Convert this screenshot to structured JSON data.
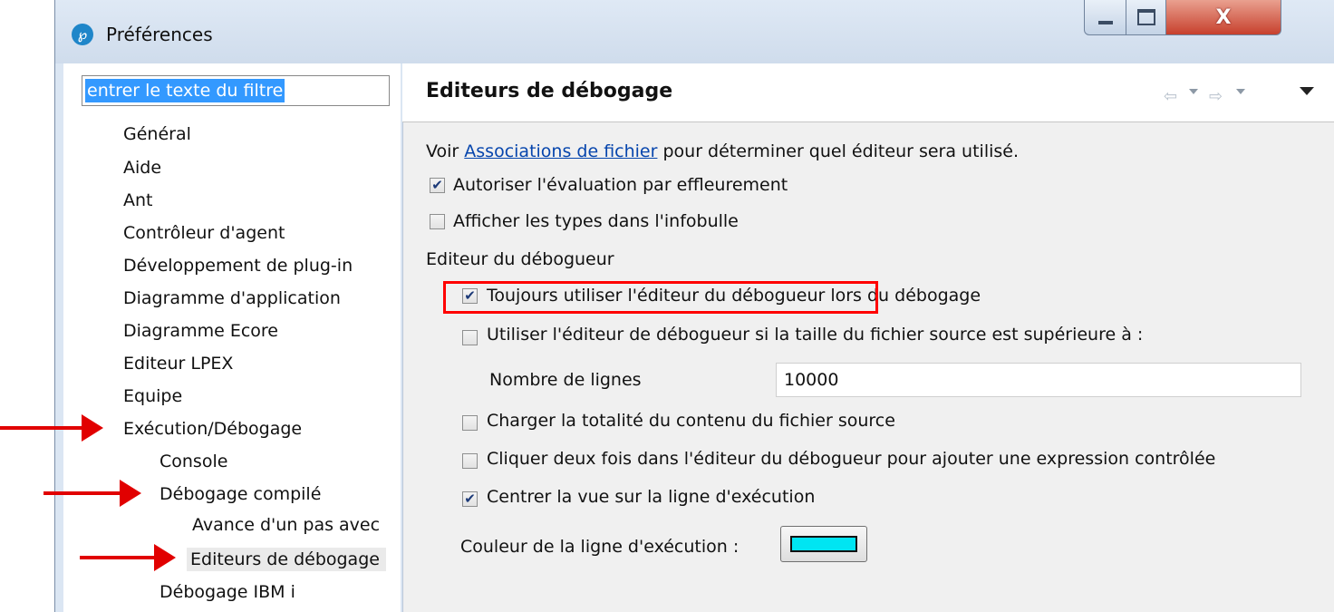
{
  "window": {
    "title": "Préférences",
    "icon": "eclipse-ide-icon",
    "close_label": "X"
  },
  "filter": {
    "value": "entrer le texte du filtre"
  },
  "tree": {
    "general": "Général",
    "aide": "Aide",
    "ant": "Ant",
    "controleur": "Contrôleur d'agent",
    "developpement": "Développement de plug-in",
    "diag_app": "Diagramme d'application",
    "diag_ecore": "Diagramme Ecore",
    "editeur_lpex": "Editeur LPEX",
    "equipe": "Equipe",
    "execution": "Exécution/Débogage",
    "console": "Console",
    "debogage_compile": "Débogage compilé",
    "avance": "Avance d'un pas avec",
    "editeurs": "Editeurs de débogage",
    "debogage_ibm": "Débogage IBM i"
  },
  "page": {
    "title": "Editeurs de débogage",
    "intro_before": "Voir ",
    "intro_link": "Associations de fichier",
    "intro_after": " pour déterminer quel éditeur sera utilisé.",
    "opt_hover": {
      "label": "Autoriser l'évaluation par effleurement",
      "checked": true
    },
    "opt_types": {
      "label": "Afficher les types dans l'infobulle",
      "checked": false
    },
    "group_label": "Editeur du débogueur",
    "opt_always": {
      "label": "Toujours utiliser l'éditeur du débogueur lors du débogage",
      "checked": true
    },
    "opt_size": {
      "label": "Utiliser l'éditeur de débogueur si la taille du fichier source est supérieure à :",
      "checked": false
    },
    "lines_label": "Nombre de lignes",
    "lines_value": "10000",
    "opt_load": {
      "label": "Charger la totalité du contenu du fichier source",
      "checked": false
    },
    "opt_dblclick": {
      "label": "Cliquer deux fois dans l'éditeur du débogueur pour ajouter une expression contrôlée",
      "checked": false
    },
    "opt_center": {
      "label": "Centrer la vue sur la ligne d'exécution",
      "checked": true
    },
    "color_label": "Couleur de la ligne d'exécution :",
    "color_value": "#00e5f2"
  },
  "annotations": {
    "arrow_color": "#e10000",
    "highlight_color": "#ff0000"
  }
}
